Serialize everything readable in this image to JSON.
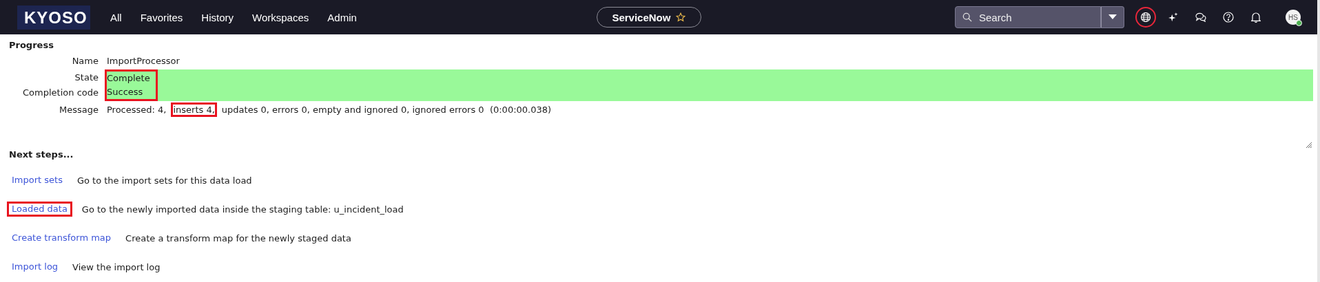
{
  "topbar": {
    "logo": "KYOSO",
    "nav": [
      "All",
      "Favorites",
      "History",
      "Workspaces",
      "Admin"
    ],
    "app_pill": {
      "label": "ServiceNow",
      "favorite": false
    },
    "search": {
      "placeholder": "Search"
    },
    "icons": [
      {
        "kind": "globe",
        "annotated": true
      },
      {
        "kind": "sparkle",
        "annotated": false
      },
      {
        "kind": "chat",
        "annotated": false
      },
      {
        "kind": "help",
        "annotated": false
      },
      {
        "kind": "bell",
        "annotated": false
      }
    ],
    "avatar": {
      "initials": "HS",
      "online": true
    }
  },
  "progress": {
    "title": "Progress",
    "groups": [
      {
        "annotated": false,
        "rows": [
          {
            "label": "Name",
            "value": "ImportProcessor"
          }
        ]
      },
      {
        "annotated": true,
        "color": "#99f999",
        "rows": [
          {
            "label": "State",
            "value": "Complete"
          },
          {
            "label": "Completion code",
            "value": "Success"
          }
        ]
      }
    ],
    "message": {
      "label": "Message",
      "segments": [
        {
          "text": "Processed: 4,",
          "annotated": false
        },
        {
          "text": "inserts 4,",
          "annotated": true
        },
        {
          "text": "updates 0, errors 0, empty and ignored 0, ignored errors 0  (0:00:00.038)",
          "annotated": false
        }
      ]
    }
  },
  "next_steps": {
    "title": "Next steps...",
    "items": [
      {
        "link": "Import sets",
        "description": "Go to the import sets for this data load",
        "annotated": false
      },
      {
        "link": "Loaded data",
        "description": "Go to the newly imported data inside the staging table: u_incident_load",
        "annotated": true
      },
      {
        "link": "Create transform map",
        "description": "Create a transform map for the newly staged data",
        "annotated": false
      },
      {
        "link": "Import log",
        "description": "View the import log",
        "annotated": false
      }
    ]
  }
}
